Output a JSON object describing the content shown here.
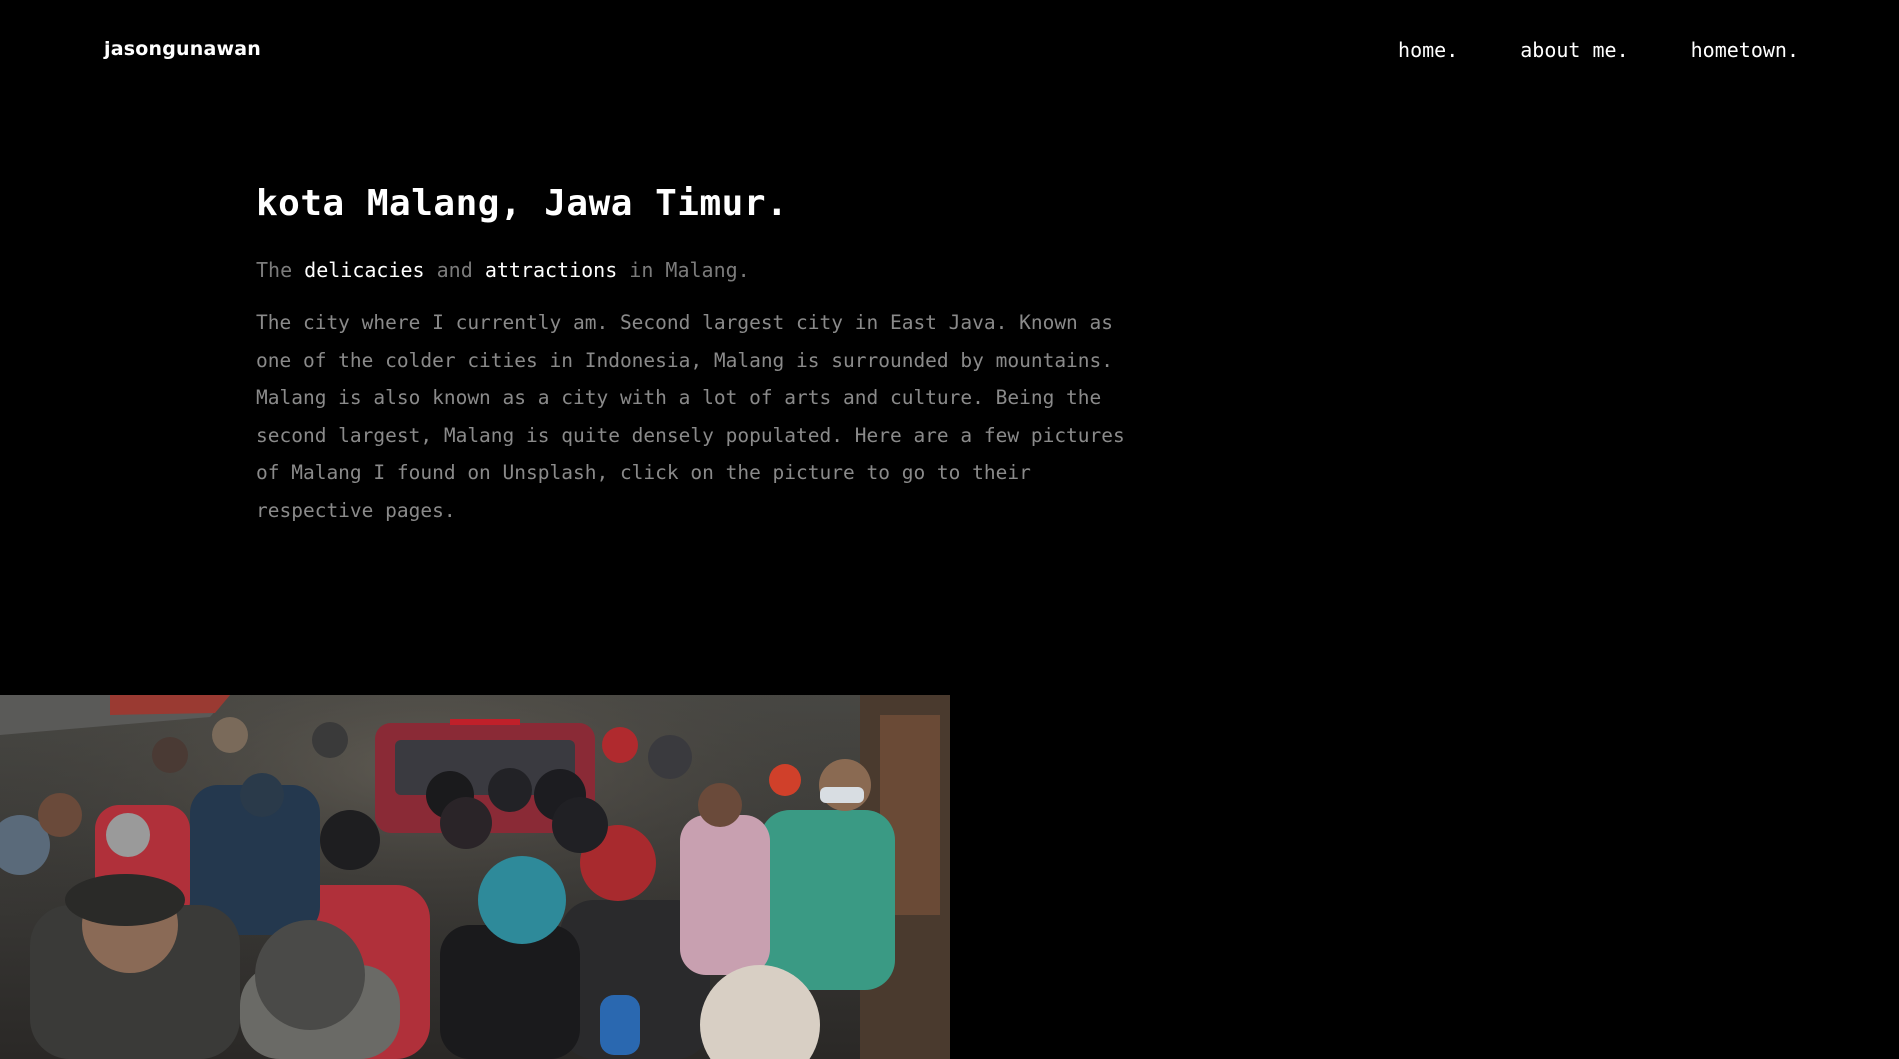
{
  "header": {
    "brand": "jasongunawan",
    "nav": [
      {
        "label": "home."
      },
      {
        "label": "about me."
      },
      {
        "label": "hometown."
      }
    ]
  },
  "main": {
    "title": "kota Malang, Jawa Timur.",
    "tagline": {
      "part1": "The ",
      "highlight1": "delicacies",
      "part2": " and ",
      "highlight2": "attractions",
      "part3": " in Malang."
    },
    "description": "The city where I currently am. Second largest city in East Java. Known as one of the colder cities in Indonesia, Malang is surrounded by mountains. Malang is also known as a city with a lot of arts and culture. Being the second largest, Malang is quite densely populated. Here are a few pictures of Malang I found on Unsplash, click on the picture to go to their respective pages."
  },
  "colors": {
    "background": "#000000",
    "text_primary": "#ffffff",
    "text_muted": "#8a8a8a"
  }
}
